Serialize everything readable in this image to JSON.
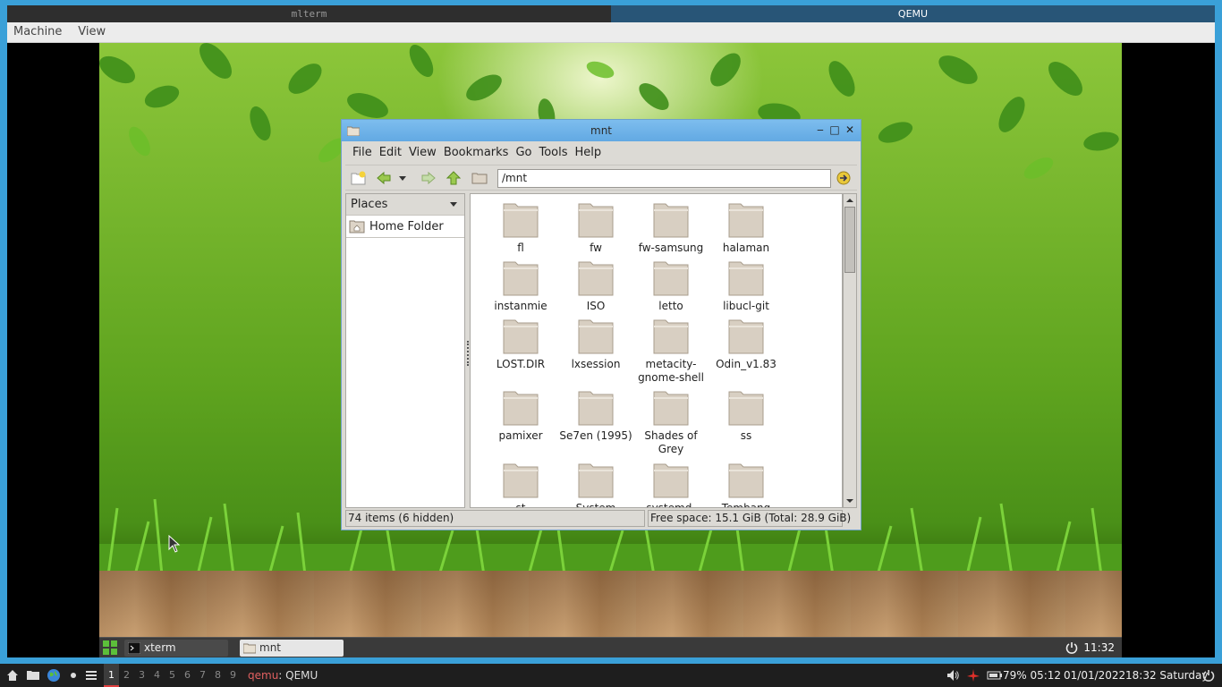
{
  "wm": {
    "tabs": [
      {
        "label": "mlterm",
        "active": false
      },
      {
        "label": "QEMU",
        "active": true
      }
    ]
  },
  "qemu": {
    "menu": [
      "Machine",
      "View"
    ]
  },
  "guest": {
    "panel": {
      "tasks": [
        "xterm",
        "mnt"
      ],
      "clock": "11:32"
    }
  },
  "fm": {
    "title": "mnt",
    "menu": [
      "File",
      "Edit",
      "View",
      "Bookmarks",
      "Go",
      "Tools",
      "Help"
    ],
    "path": "/mnt",
    "places_header": "Places",
    "places": [
      "Home Folder"
    ],
    "items": [
      "fl",
      "fw",
      "fw-samsung",
      "halaman",
      "instanmie",
      "ISO",
      "letto",
      "libucl-git",
      "LOST.DIR",
      "lxsession",
      "metacity-gnome-shell",
      "Odin_v1.83",
      "pamixer",
      "Se7en (1995)",
      "Shades of Grey",
      "ss",
      "st",
      "System",
      "systemd-",
      "Tembang"
    ],
    "status_left": "74 items (6 hidden)",
    "status_right": "Free space: 15.1 GiB (Total: 28.9 GiB)"
  },
  "host_panel": {
    "workspaces": [
      "1",
      "2",
      "3",
      "4",
      "5",
      "6",
      "7",
      "8",
      "9"
    ],
    "active_workspace": "1",
    "active_app": "qemu",
    "active_title": "QEMU",
    "battery": "79% 05:12",
    "date": "01/01/2022",
    "time": "18:32 Saturday"
  },
  "colors": {
    "wm_active_tab": "#285577",
    "fm_titlebar": "#62a9e3",
    "folder": "#d8cfc2",
    "host_panel": "#1e1e1e",
    "workspace_accent": "#e04040"
  },
  "icons": [
    "home-icon",
    "folder-icon",
    "globe-icon",
    "dot-icon",
    "list-icon",
    "volume-icon",
    "network-icon",
    "battery-icon",
    "power-icon"
  ]
}
